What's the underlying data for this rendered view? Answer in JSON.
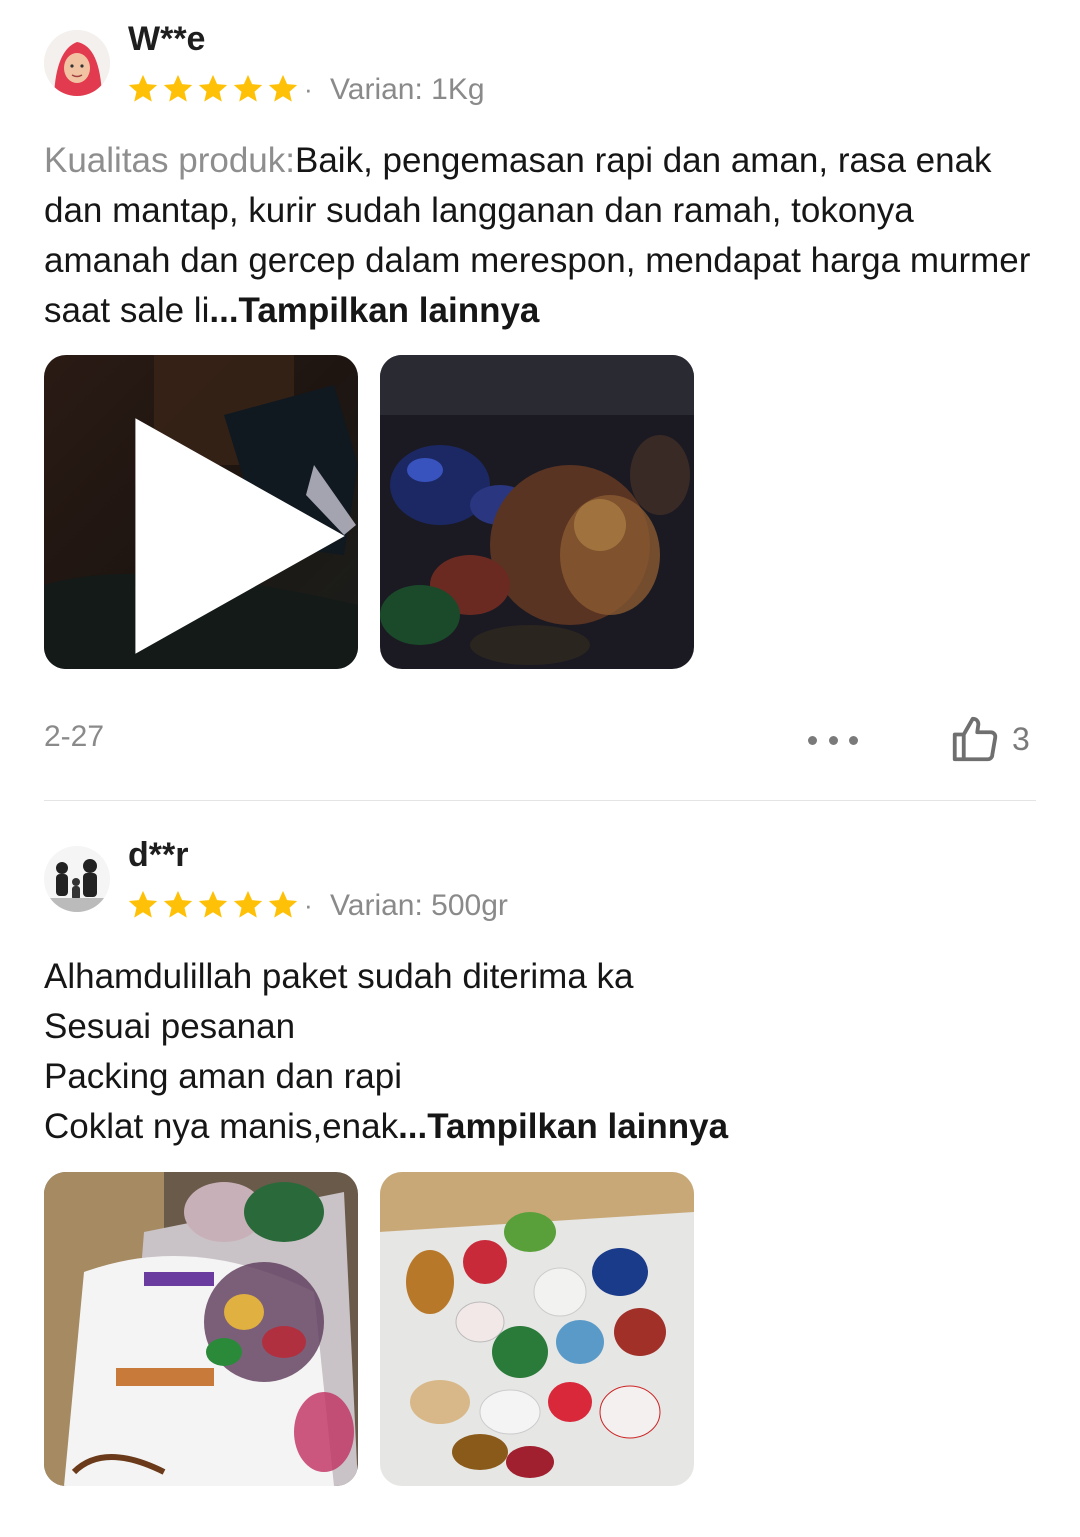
{
  "reviews": [
    {
      "username": "W**e",
      "rating": 5,
      "separator": "·",
      "variant": "Varian: 1Kg",
      "text_label": "Kualitas produk:",
      "text": "Baik, pengemasan rapi dan aman, rasa enak dan mantap, kurir sudah langganan dan ramah, tokonya amanah dan gercep dalam merespon, mendapat harga murmer saat sale li",
      "more_label": "...Tampilkan lainnya",
      "date": "2-27",
      "likes": "3"
    },
    {
      "username": "d**r",
      "rating": 5,
      "separator": "·",
      "variant": "Varian: 500gr",
      "text_lines": [
        "Alhamdulillah paket sudah diterima ka",
        "Sesuai pesanan",
        "Packing aman dan rapi",
        "Coklat nya manis,enak"
      ],
      "more_label": "...Tampilkan lainnya"
    }
  ],
  "colors": {
    "star": "#FFC107",
    "muted_text": "#8A8A8A",
    "divider": "#E4E4E4"
  },
  "icons": [
    "star-icon",
    "play-icon",
    "more-options-icon",
    "thumbs-up-icon"
  ]
}
